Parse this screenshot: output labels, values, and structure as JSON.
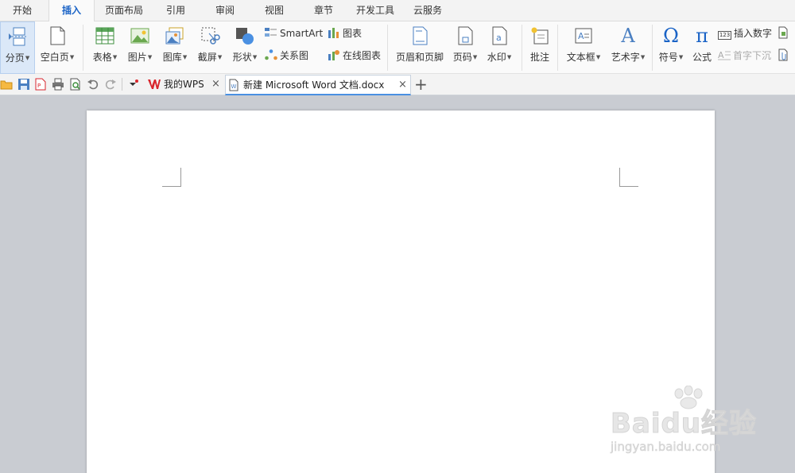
{
  "menu": {
    "tabs": [
      {
        "label": "开始"
      },
      {
        "label": "插入"
      },
      {
        "label": "页面布局"
      },
      {
        "label": "引用"
      },
      {
        "label": "审阅"
      },
      {
        "label": "视图"
      },
      {
        "label": "章节"
      },
      {
        "label": "开发工具"
      },
      {
        "label": "云服务"
      }
    ],
    "active": "插入"
  },
  "ribbon": {
    "page_break": "分页",
    "blank_page": "空白页",
    "table": "表格",
    "picture": "图片",
    "gallery": "图库",
    "screenshot": "截屏",
    "shapes": "形状",
    "smartart": "SmartArt",
    "relation": "关系图",
    "chart": "图表",
    "online_chart": "在线图表",
    "header_footer": "页眉和页脚",
    "page_number": "页码",
    "watermark": "水印",
    "comment": "批注",
    "textbox": "文本框",
    "wordart": "艺术字",
    "symbol": "符号",
    "formula": "公式",
    "insert_number": "插入数字",
    "drop_cap": "首字下沉",
    "text_a": "A",
    "omega": "Ω",
    "pi": "π",
    "badge_123": "123"
  },
  "tabs": {
    "my_wps": "我的WPS",
    "document": "新建 Microsoft Word 文档.docx",
    "close": "×",
    "new": "+"
  },
  "watermark": {
    "logo": "Baidu经验",
    "url": "jingyan.baidu.com"
  },
  "colors": {
    "accent": "#1a63c6",
    "wps_red": "#d9262c",
    "canvas_bg": "#c9ccd2"
  }
}
